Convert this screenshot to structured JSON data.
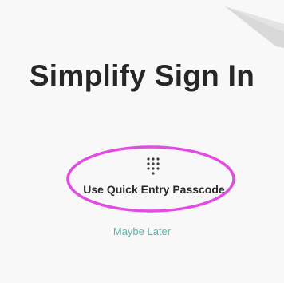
{
  "screen": {
    "title": "Simplify Sign In",
    "passcode_button_label": "Use Quick Entry Passcode",
    "passcode_button_icon": "keypad-icon",
    "maybe_later_label": "Maybe Later",
    "highlight_color": "#e04de0",
    "link_color": "#5fb3ad",
    "corner_decoration_icon": "arrow-icon"
  }
}
